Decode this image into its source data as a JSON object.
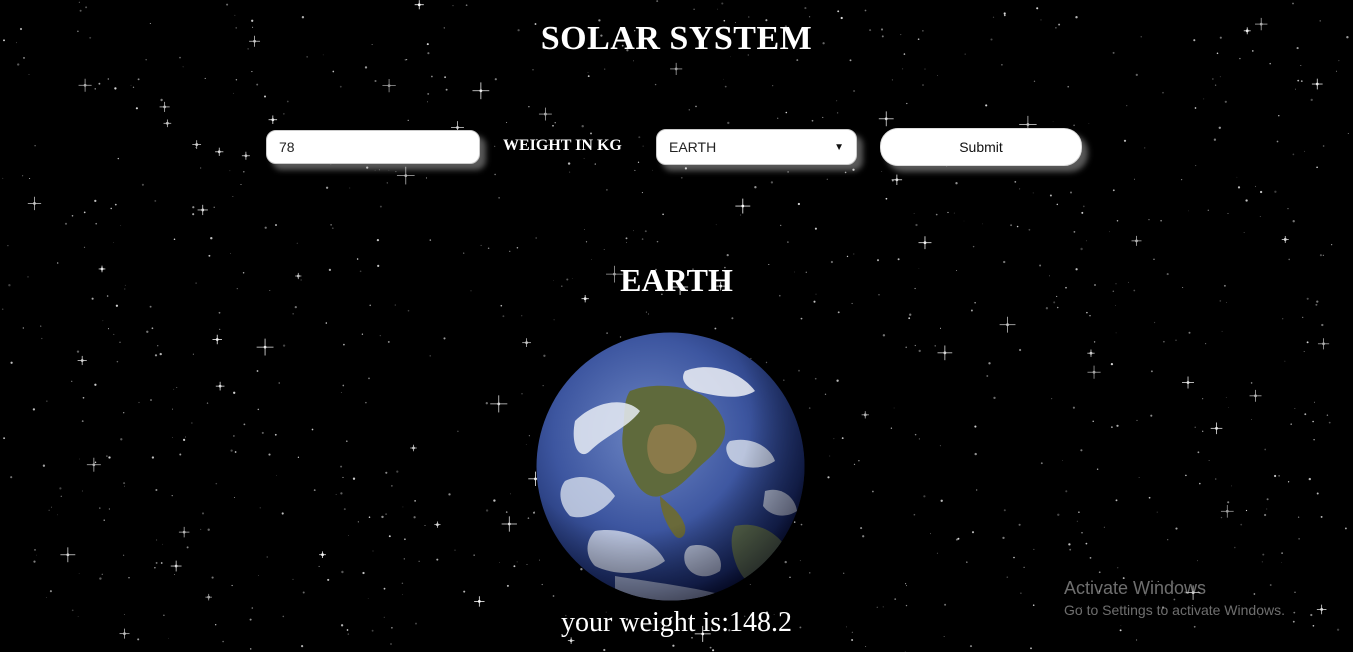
{
  "page": {
    "title": "SOLAR SYSTEM"
  },
  "form": {
    "weight_value": "78",
    "weight_label": "WEIGHT IN KG",
    "planet_selected": "EARTH",
    "submit_label": "Submit"
  },
  "result": {
    "planet_name": "EARTH",
    "weight_text": "your weight is:148.2"
  },
  "watermark": {
    "title": "Activate Windows",
    "subtitle": "Go to Settings to activate Windows."
  },
  "colors": {
    "background": "#000000",
    "text": "#ffffff",
    "control_bg": "#ffffff"
  },
  "icons": {
    "select_arrow": "chevron-down-icon",
    "planet": "earth-globe-image"
  }
}
